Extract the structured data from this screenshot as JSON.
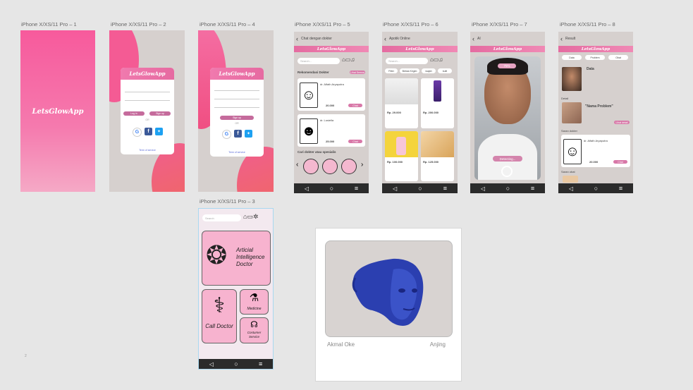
{
  "artboards": {
    "a1": {
      "label": "iPhone X/XS/11 Pro – 1"
    },
    "a2": {
      "label": "iPhone X/XS/11 Pro – 2"
    },
    "a4": {
      "label": "iPhone X/XS/11 Pro – 4"
    },
    "a5": {
      "label": "iPhone X/XS/11 Pro – 5"
    },
    "a6": {
      "label": "iPhone X/XS/11 Pro – 6"
    },
    "a7": {
      "label": "iPhone X/XS/11 Pro – 7"
    },
    "a8": {
      "label": "iPhone X/XS/11 Pro – 8"
    },
    "a3": {
      "label": "iPhone X/XS/11 Pro – 3"
    }
  },
  "app": {
    "logo": "LetsGlowApp"
  },
  "login": {
    "login_button": "Log in",
    "signup_button": "Sign up",
    "or_text": "OR",
    "terms": "Term of service"
  },
  "signup": {
    "signup_button": "Sign up",
    "or_text": "OR",
    "terms": "Term of service"
  },
  "chat_doctor": {
    "title": "Chat dengan dokter",
    "search_placeholder": "Search...",
    "recommend_title": "Rekomendasi Dokter",
    "view_all": "Lihat Semua",
    "doctors": [
      {
        "name": "dr. Alfath Aryaputra",
        "fee": "20.000",
        "action": "Chat"
      },
      {
        "name": "dr. Lusiella",
        "fee": "25.000",
        "action": "Chat"
      }
    ],
    "specialist_title": "Cari dokter atau spesialis"
  },
  "shop": {
    "title": "Apotik Online",
    "search_placeholder": "Search...",
    "filters": [
      "Filter",
      "Bebas Kirgim",
      "wajah",
      "kulit"
    ],
    "products": [
      {
        "price": "Rp. 29.000"
      },
      {
        "price": "Rp. 200.000"
      },
      {
        "price": "Rp. 100.000"
      },
      {
        "price": "Rp. 125.000"
      }
    ]
  },
  "ai_scan": {
    "title": "AI",
    "score": "75%",
    "detecting": "Detecting..."
  },
  "result": {
    "title": "Result",
    "tabs": [
      "Data",
      "Problem",
      "Obat"
    ],
    "data_heading": "Data",
    "detail_heading": "Detail",
    "problem_title": "\"Nama Problem\"",
    "lihat": "Lihat detail",
    "saran_dokter": "Saran dokter",
    "doctor_name": "dr. Alfath Aryaputra",
    "doctor_fee": "20.000",
    "chat": "Chat",
    "saran_obat": "Saran obat"
  },
  "home": {
    "search_placeholder": "Search",
    "ai_doctor_label": "Articial Intelligence Doctor",
    "call_doctor_label": "Call Doctor",
    "medicine_label": "Medicine",
    "costumer_service_label": "Costumer Service"
  },
  "face_card": {
    "left_label": "Akmal Oke",
    "right_label": "Anjing"
  },
  "colors": {
    "pink_primary": "#f36ba3",
    "pink_light": "#f7b3cf",
    "coral": "#ef5a5a",
    "canvas": "#e6e6e6",
    "phone_gray": "#d6d0ce",
    "navbar": "#2b2b2b",
    "face_blue": "#2b3fb0"
  },
  "misc": {
    "canvas_marker": "2"
  }
}
